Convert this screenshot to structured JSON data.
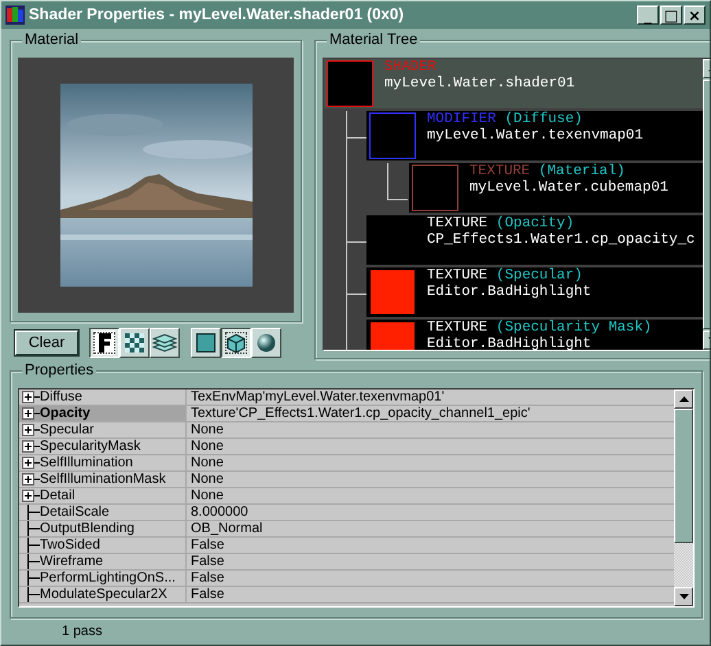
{
  "window": {
    "title": "Shader Properties - myLevel.Water.shader01 (0x0)",
    "controls": [
      "_",
      "□",
      "×"
    ]
  },
  "material": {
    "title": "Material"
  },
  "clear_button": "Clear",
  "view_buttons": [
    {
      "selected": true
    },
    {
      "selected": false
    },
    {
      "selected": false
    },
    {
      "selected": false
    },
    {
      "selected": true
    },
    {
      "selected": false
    }
  ],
  "material_tree": {
    "title": "Material Tree",
    "nodes": [
      {
        "type": "SHADER",
        "name": "myLevel.Water.shader01",
        "color": "#e01010",
        "bad": false,
        "selected": true,
        "children": [
          {
            "type": "MODIFIER",
            "slot": "(Diffuse)",
            "name": "myLevel.Water.texenvmap01",
            "color": "#3030ff",
            "bad": false,
            "selected": false,
            "children": [
              {
                "type": "TEXTURE",
                "slot": "(Material)",
                "name": "myLevel.Water.cubemap01",
                "color": "#904038",
                "bad": false,
                "selected": false
              }
            ]
          },
          {
            "type": "TEXTURE",
            "slot": "(Opacity)",
            "name": "CP_Effects1.Water1.cp_opacity_c",
            "color": "#ffffff",
            "bad": false,
            "selected": false
          },
          {
            "type": "TEXTURE",
            "slot": "(Specular)",
            "name": "Editor.BadHighlight",
            "color": "#ffffff",
            "bad": true,
            "selected": false
          },
          {
            "type": "TEXTURE",
            "slot": "(Specularity Mask)",
            "name": "Editor.BadHighlight",
            "color": "#ffffff",
            "bad": true,
            "selected": false
          }
        ]
      }
    ]
  },
  "properties": {
    "title": "Properties",
    "rows": [
      {
        "name": "Diffuse",
        "value": "TexEnvMap'myLevel.Water.texenvmap01'",
        "expandable": true,
        "selected": false
      },
      {
        "name": "Opacity",
        "value": "Texture'CP_Effects1.Water1.cp_opacity_channel1_epic'",
        "expandable": true,
        "selected": true
      },
      {
        "name": "Specular",
        "value": "None",
        "expandable": true,
        "selected": false
      },
      {
        "name": "SpecularityMask",
        "value": "None",
        "expandable": true,
        "selected": false
      },
      {
        "name": "SelfIllumination",
        "value": "None",
        "expandable": true,
        "selected": false
      },
      {
        "name": "SelfIlluminationMask",
        "value": "None",
        "expandable": true,
        "selected": false
      },
      {
        "name": "Detail",
        "value": "None",
        "expandable": true,
        "selected": false
      },
      {
        "name": "DetailScale",
        "value": "8.000000",
        "expandable": false,
        "selected": false
      },
      {
        "name": "OutputBlending",
        "value": "OB_Normal",
        "expandable": false,
        "selected": false
      },
      {
        "name": "TwoSided",
        "value": "False",
        "expandable": false,
        "selected": false
      },
      {
        "name": "Wireframe",
        "value": "False",
        "expandable": false,
        "selected": false
      },
      {
        "name": "PerformLightingOnS...",
        "value": "False",
        "expandable": false,
        "selected": false
      },
      {
        "name": "ModulateSpecular2X",
        "value": "False",
        "expandable": false,
        "selected": false
      }
    ]
  },
  "status_bar": "1 pass"
}
